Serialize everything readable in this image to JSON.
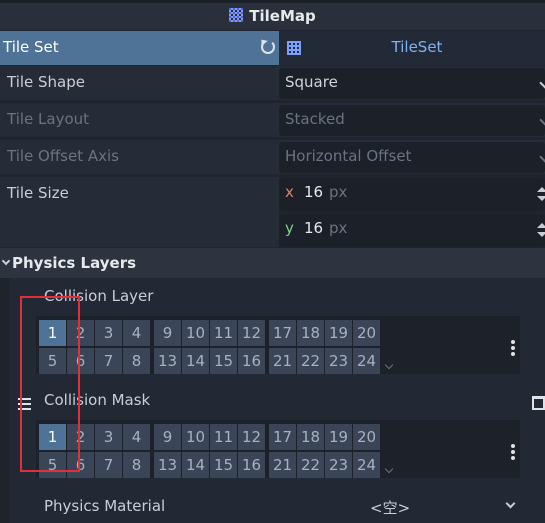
{
  "header": {
    "title": "TileMap",
    "icon": "tilemap-icon"
  },
  "tile_set": {
    "label": "Tile Set",
    "value": "TileSet",
    "revert_icon": "revert-icon",
    "resource_icon": "tileset-icon"
  },
  "properties": [
    {
      "label": "Tile Shape",
      "value": "Square",
      "enabled": true
    },
    {
      "label": "Tile Layout",
      "value": "Stacked",
      "enabled": false
    },
    {
      "label": "Tile Offset Axis",
      "value": "Horizontal Offset",
      "enabled": false
    }
  ],
  "tile_size": {
    "label": "Tile Size",
    "x_axis": "x",
    "x": "16",
    "y_axis": "y",
    "y": "16",
    "unit": "px"
  },
  "section": {
    "title": "Physics Layers"
  },
  "collision_layer": {
    "label": "Collision Layer",
    "row1": [
      "1",
      "2",
      "3",
      "4",
      "9",
      "10",
      "11",
      "12",
      "17",
      "18",
      "19",
      "20"
    ],
    "row2": [
      "5",
      "6",
      "7",
      "8",
      "13",
      "14",
      "15",
      "16",
      "21",
      "22",
      "23",
      "24"
    ],
    "selected": [
      "1"
    ]
  },
  "collision_mask": {
    "label": "Collision Mask",
    "row1": [
      "1",
      "2",
      "3",
      "4",
      "9",
      "10",
      "11",
      "12",
      "17",
      "18",
      "19",
      "20"
    ],
    "row2": [
      "5",
      "6",
      "7",
      "8",
      "13",
      "14",
      "15",
      "16",
      "21",
      "22",
      "23",
      "24"
    ],
    "selected": [
      "1"
    ]
  },
  "physics_material": {
    "label": "Physics Material",
    "value": "<空>"
  },
  "colors": {
    "accent": "#4f7396",
    "highlight": "#e0303a",
    "x_axis": "#e0836a",
    "y_axis": "#7fd08a",
    "link": "#7fb2f0"
  }
}
